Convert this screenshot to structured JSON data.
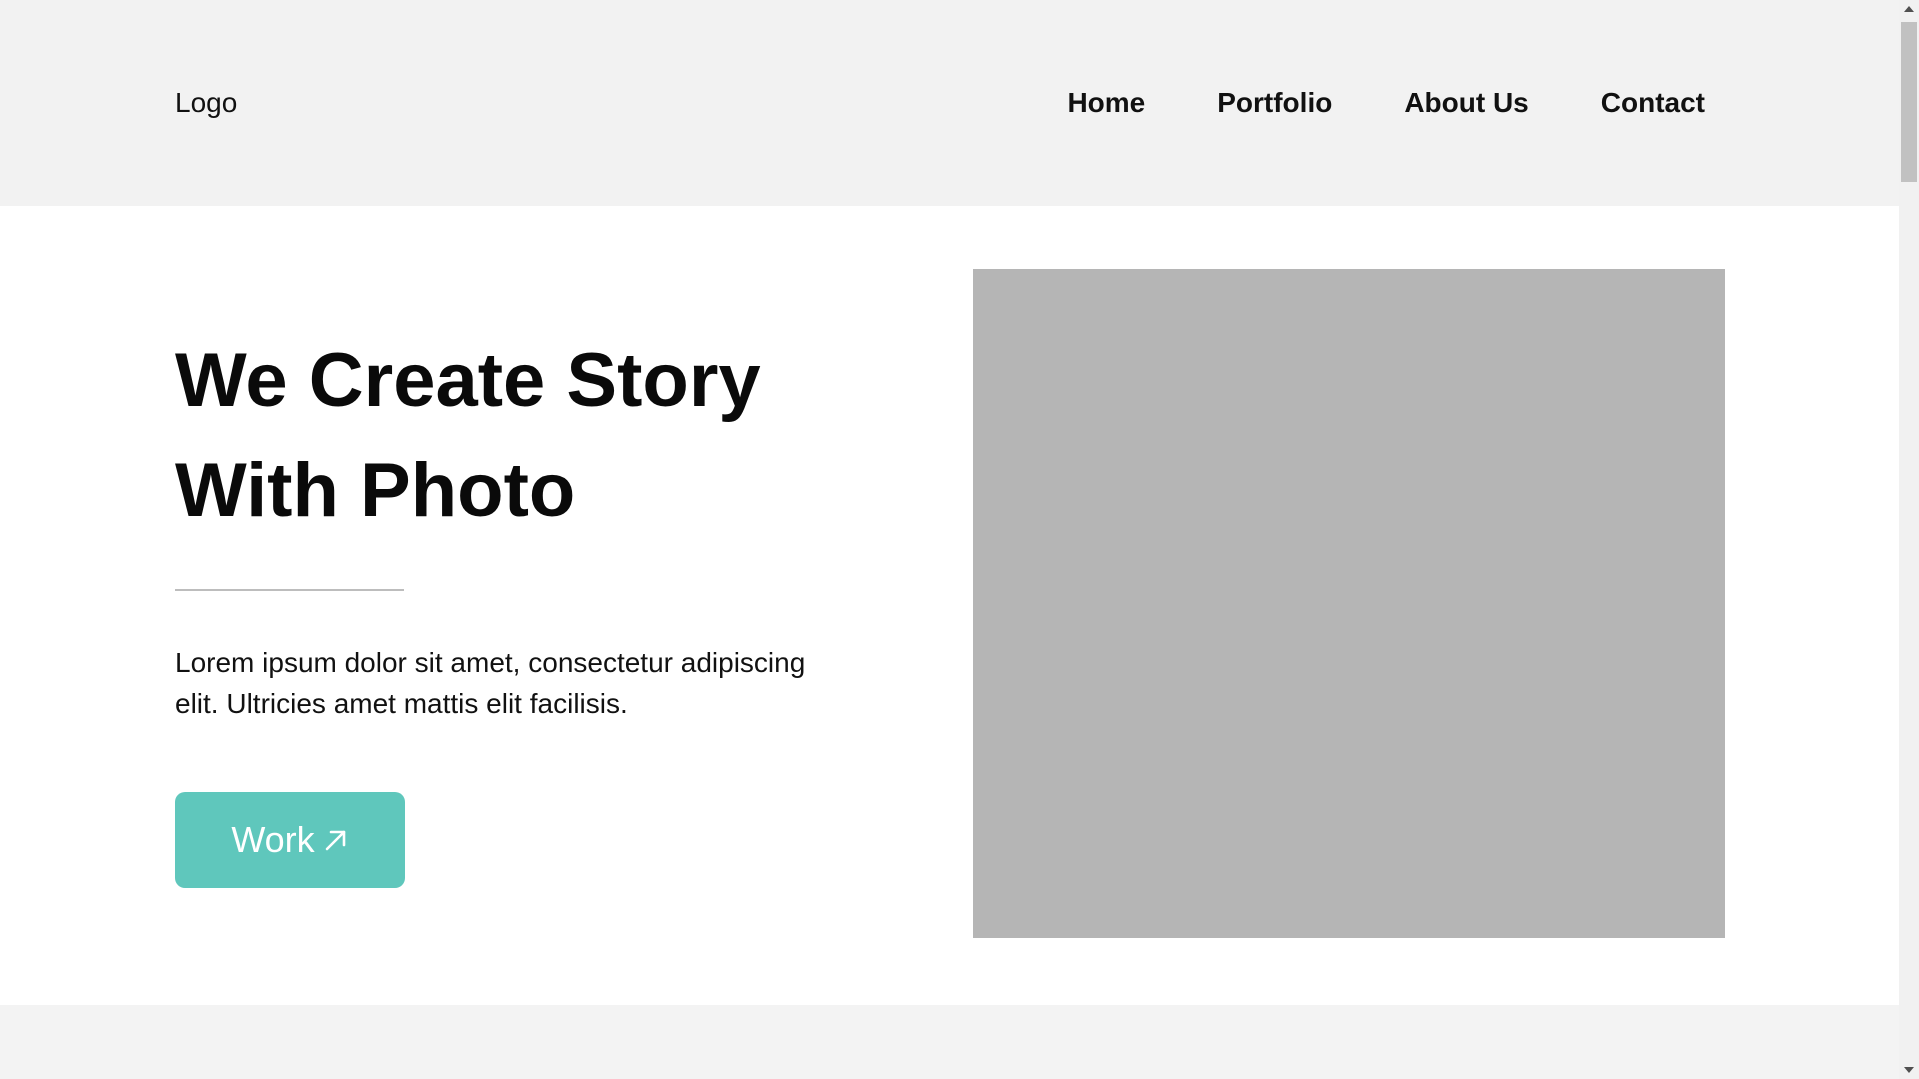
{
  "header": {
    "logo": "Logo",
    "nav": [
      "Home",
      "Portfolio",
      "About Us",
      "Contact"
    ]
  },
  "hero": {
    "title_lines": [
      "We Create Story",
      "With Photo"
    ],
    "text_lines": [
      "Lorem ipsum dolor sit amet, consectetur adipiscing",
      "elit. Ultricies amet mattis elit facilisis."
    ],
    "cta_label": "Work",
    "cta_icon": "arrow-up-right-icon"
  },
  "colors": {
    "header_bg": "#f2f2f2",
    "accent": "#5fc7bc",
    "image_placeholder": "#b5b5b5",
    "text": "#111111"
  }
}
